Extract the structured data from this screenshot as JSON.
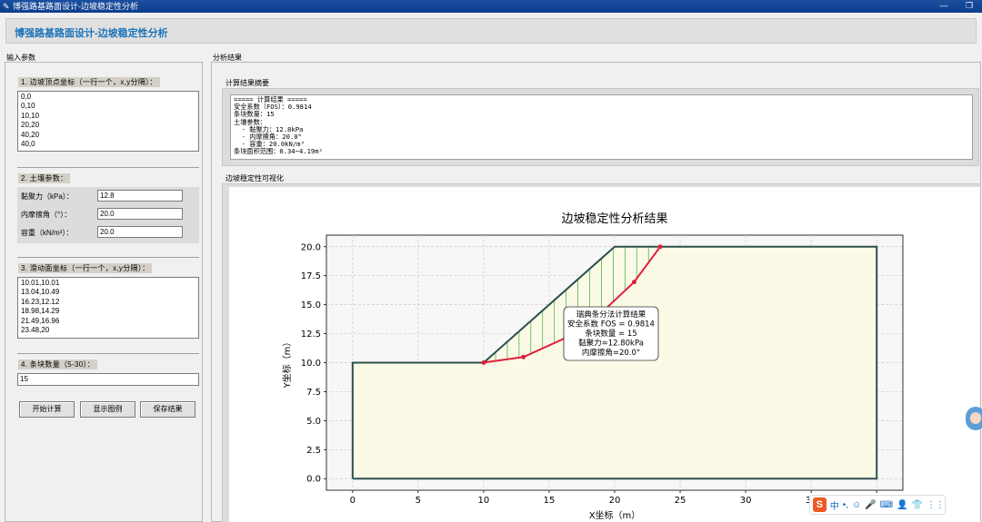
{
  "window": {
    "title": "博强路基路面设计-边坡稳定性分析",
    "min_symbol": "—",
    "restore_symbol": "❐"
  },
  "header": {
    "title": "博强路基路面设计-边坡稳定性分析"
  },
  "input_panel": {
    "label": "输入参数",
    "vertices": {
      "label": "1. 边坡顶点坐标（一行一个，x,y分隔）：",
      "lines": [
        "0,0",
        "0,10",
        "10,10",
        "20,20",
        "40,20",
        "40,0"
      ]
    },
    "soil": {
      "label": "2. 土壤参数：",
      "cohesion_label": "黏聚力（kPa）：",
      "cohesion_value": "12.8",
      "friction_label": "内摩擦角（°）：",
      "friction_value": "20.0",
      "unit_weight_label": "容重（kN/m³）：",
      "unit_weight_value": "20.0"
    },
    "slip": {
      "label": "3. 滑动面坐标（一行一个，x,y分隔）：",
      "lines": [
        "10.01,10.01",
        "13.04,10.49",
        "16.23,12.12",
        "18.98,14.29",
        "21.49,16.96",
        "23.48,20"
      ]
    },
    "slices": {
      "label": "4. 条块数量（5-30）：",
      "value": "15"
    },
    "buttons": {
      "calculate": "开始计算",
      "legend": "显示图例",
      "save": "保存结果"
    }
  },
  "result_panel": {
    "label": "分析结果",
    "summary_label": "计算结果摘要",
    "summary_text": "===== 计算结果 =====\n安全系数（FOS）：0.9814\n条块数量：15\n土壤参数：\n  - 黏聚力：12.8kPa\n  - 内摩擦角：20.0°\n  - 容重：20.0kN/m³\n条块面积范围：0.34~4.19m²",
    "viz_label": "边坡稳定性可视化"
  },
  "chart_data": {
    "type": "line",
    "title": "边坡稳定性分析结果",
    "xlabel": "X坐标（m）",
    "ylabel": "Y坐标（m）",
    "xlim": [
      -2,
      42
    ],
    "ylim": [
      -1,
      21
    ],
    "xticks": [
      0,
      5,
      10,
      15,
      20,
      25,
      30,
      35,
      40
    ],
    "yticks": [
      0.0,
      2.5,
      5.0,
      7.5,
      10.0,
      12.5,
      15.0,
      17.5,
      20.0
    ],
    "grid": true,
    "slope_profile": [
      [
        0,
        0
      ],
      [
        0,
        10
      ],
      [
        10,
        10
      ],
      [
        20,
        20
      ],
      [
        40,
        20
      ],
      [
        40,
        0
      ],
      [
        0,
        0
      ]
    ],
    "slip_surface": [
      [
        10.01,
        10.01
      ],
      [
        13.04,
        10.49
      ],
      [
        16.23,
        12.12
      ],
      [
        18.98,
        14.29
      ],
      [
        21.49,
        16.96
      ],
      [
        23.48,
        20
      ]
    ],
    "slice_count": 15,
    "annotation": {
      "lines": [
        "瑞典条分法计算结果",
        "安全系数 FOS = 0.9814",
        "条块数量 = 15",
        "黏聚力=12.80kPa",
        "内摩擦角=20.0°"
      ]
    },
    "colors": {
      "soil_fill": "#fafae6",
      "profile": "#2f4f4f",
      "slip": "#e0203a",
      "slice": "#3caa3c",
      "grid": "#cccccc"
    }
  },
  "taskbar_ime": {
    "logo": "S",
    "lang": "中",
    "items": [
      "•,",
      "☺",
      "🎤",
      "⌨",
      "👤",
      "👕",
      "⋮⋮"
    ]
  }
}
